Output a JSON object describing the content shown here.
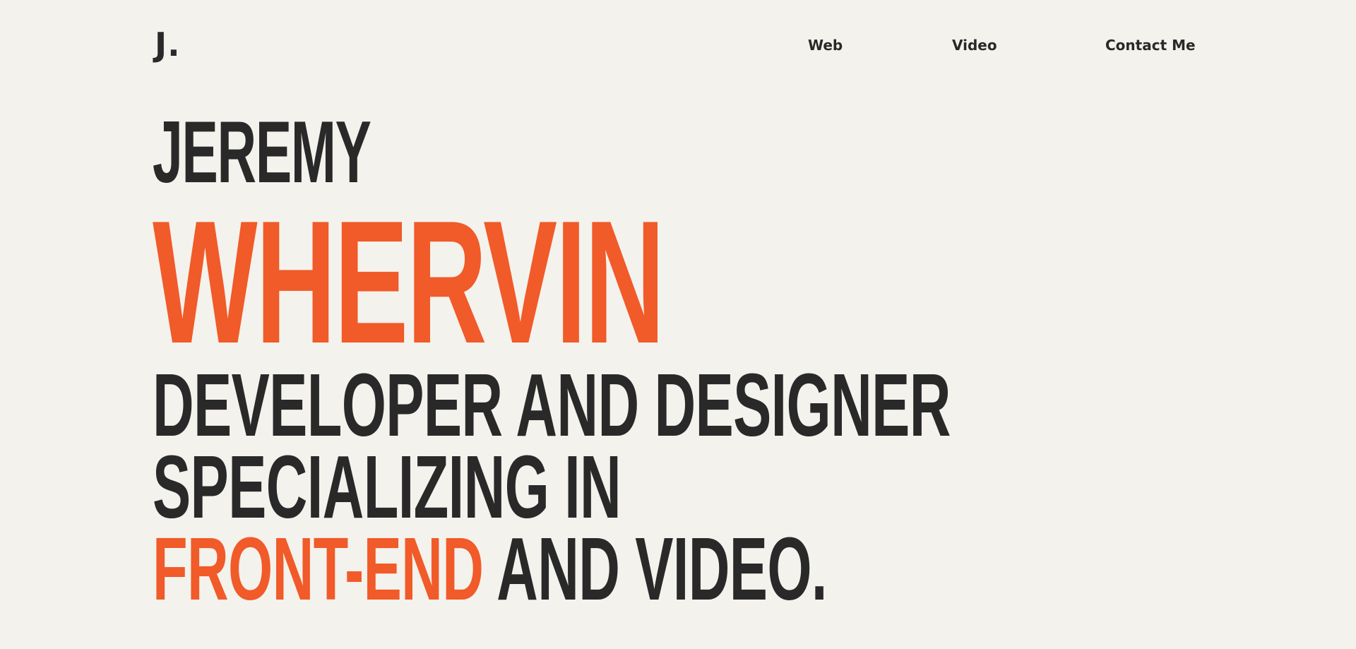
{
  "header": {
    "logo": "J.",
    "nav": {
      "web": "Web",
      "video": "Video",
      "contact": "Contact Me"
    }
  },
  "hero": {
    "first_name": "JEREMY",
    "last_name": "WHERVIN",
    "line1": "DEVELOPER AND DESIGNER",
    "line2": "SPECIALIZING IN",
    "line3_accent": "FRONT-END",
    "line3_rest": " AND VIDEO."
  },
  "colors": {
    "background": "#f4f2ec",
    "text": "#292929",
    "accent": "#f15a29"
  }
}
